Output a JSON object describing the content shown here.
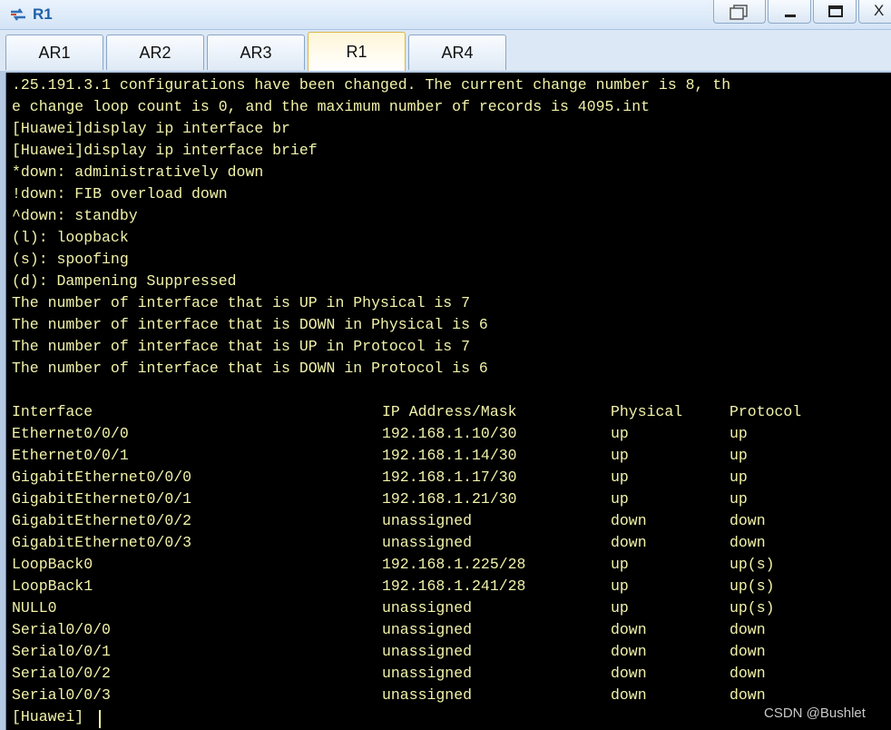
{
  "window": {
    "title": "R1",
    "close_glyph": "X"
  },
  "tabs": [
    {
      "label": "AR1",
      "active": false
    },
    {
      "label": "AR2",
      "active": false
    },
    {
      "label": "AR3",
      "active": false
    },
    {
      "label": "R1",
      "active": true
    },
    {
      "label": "AR4",
      "active": false
    }
  ],
  "terminal": {
    "header_lines": [
      ".25.191.3.1 configurations have been changed. The current change number is 8, th",
      "e change loop count is 0, and the maximum number of records is 4095.int",
      "[Huawei]display ip interface br",
      "[Huawei]display ip interface brief",
      "*down: administratively down",
      "!down: FIB overload down",
      "^down: standby",
      "(l): loopback",
      "(s): spoofing",
      "(d): Dampening Suppressed",
      "The number of interface that is UP in Physical is 7",
      "The number of interface that is DOWN in Physical is 6",
      "The number of interface that is UP in Protocol is 7",
      "The number of interface that is DOWN in Protocol is 6"
    ],
    "columns": [
      "Interface",
      "IP Address/Mask",
      "Physical",
      "Protocol"
    ],
    "rows": [
      [
        "Ethernet0/0/0",
        "192.168.1.10/30",
        "up",
        "up"
      ],
      [
        "Ethernet0/0/1",
        "192.168.1.14/30",
        "up",
        "up"
      ],
      [
        "GigabitEthernet0/0/0",
        "192.168.1.17/30",
        "up",
        "up"
      ],
      [
        "GigabitEthernet0/0/1",
        "192.168.1.21/30",
        "up",
        "up"
      ],
      [
        "GigabitEthernet0/0/2",
        "unassigned",
        "down",
        "down"
      ],
      [
        "GigabitEthernet0/0/3",
        "unassigned",
        "down",
        "down"
      ],
      [
        "LoopBack0",
        "192.168.1.225/28",
        "up",
        "up(s)"
      ],
      [
        "LoopBack1",
        "192.168.1.241/28",
        "up",
        "up(s)"
      ],
      [
        "NULL0",
        "unassigned",
        "up",
        "up(s)"
      ],
      [
        "Serial0/0/0",
        "unassigned",
        "down",
        "down"
      ],
      [
        "Serial0/0/1",
        "unassigned",
        "down",
        "down"
      ],
      [
        "Serial0/0/2",
        "unassigned",
        "down",
        "down"
      ],
      [
        "Serial0/0/3",
        "unassigned",
        "down",
        "down"
      ]
    ],
    "prompt": "[Huawei]"
  },
  "watermark": "CSDN @Bushlet",
  "colors": {
    "terminal_bg": "#000000",
    "terminal_text": "#f2f2aa",
    "title_text": "#1f5fa8"
  }
}
